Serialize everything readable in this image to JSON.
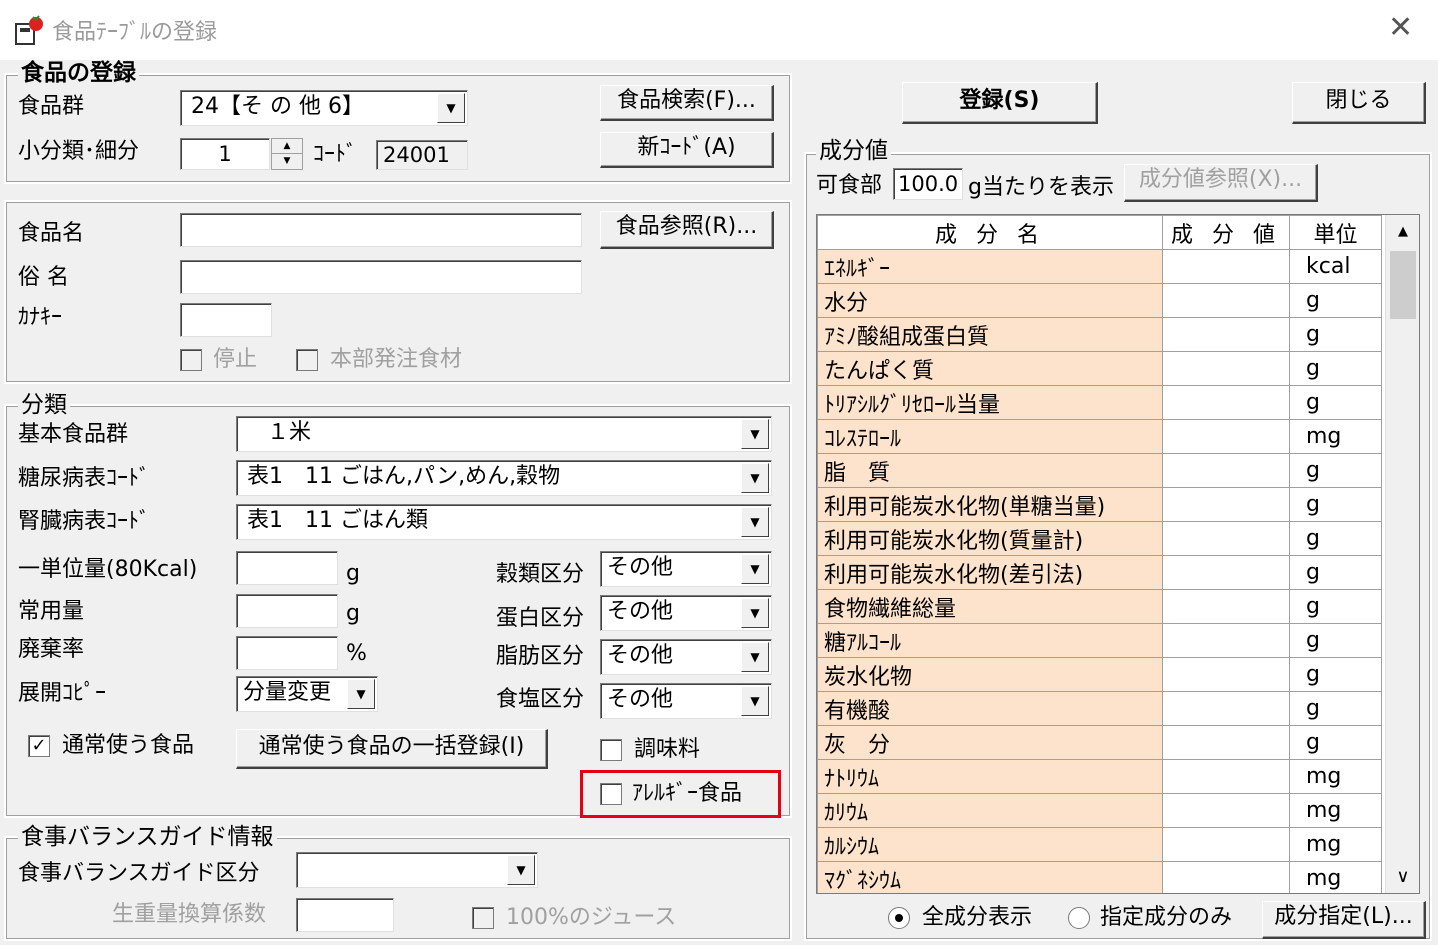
{
  "window": {
    "title": "食品ﾃｰﾌﾞﾙの登録",
    "close_glyph": "✕"
  },
  "food_reg": {
    "group_title": "食品の登録",
    "food_group_label": "食品群",
    "food_group_value": "24【そ の 他 6】",
    "subclass_label": "小分類･細分",
    "subclass_value": "1",
    "code_label": "ｺｰﾄﾞ",
    "code_value": "24001",
    "search_button": "食品検索(F)...",
    "newcode_button": "新ｺｰﾄﾞ(A)"
  },
  "top_buttons": {
    "register": "登録(S)",
    "close": "閉じる"
  },
  "name_section": {
    "food_name_label": "食品名",
    "common_name_label": "俗 名",
    "kana_key_label": "ｶﾅｷｰ",
    "food_ref_button": "食品参照(R)...",
    "stop_label": "停止",
    "hq_order_label": "本部発注食材"
  },
  "classification": {
    "group_title": "分類",
    "basic_group_label": "基本食品群",
    "basic_group_value": "１米",
    "diabetes_label": "糖尿病表ｺｰﾄﾞ",
    "diabetes_value": "表1　11 ごはん,パン,めん,穀物",
    "kidney_label": "腎臓病表ｺｰﾄﾞ",
    "kidney_value": "表1　11 ごはん類",
    "unit_label": "一単位量(80Kcal)",
    "unit_suffix": "g",
    "normal_amount_label": "常用量",
    "normal_suffix": "g",
    "waste_label": "廃棄率",
    "waste_suffix": "%",
    "expand_copy_label": "展開ｺﾋﾟｰ",
    "expand_copy_value": "分量変更",
    "grain_label": "穀類区分",
    "grain_value": "その他",
    "protein_label": "蛋白区分",
    "protein_value": "その他",
    "fat_label": "脂肪区分",
    "fat_value": "その他",
    "salt_label": "食塩区分",
    "salt_value": "その他",
    "usual_food_label": "通常使う食品",
    "usual_food_checked": true,
    "bulk_button": "通常使う食品の一括登録(I)",
    "seasoning_label": "調味料",
    "allergy_label": "ｱﾚﾙｷﾞｰ食品"
  },
  "balance": {
    "group_title": "食事バランスガイド情報",
    "category_label": "食事バランスガイド区分",
    "factor_label": "生重量換算係数",
    "juice_label": "100%のジュース"
  },
  "nutrients": {
    "group_title": "成分値",
    "edible_label": "可食部",
    "edible_value": "100.0",
    "per_label": "g当たりを表示",
    "ref_button": "成分値参照(X)...",
    "headers": [
      "成 分 名",
      "成 分 値",
      "単位"
    ],
    "rows": [
      {
        "name": "ｴﾈﾙｷﾞｰ",
        "unit": "kcal"
      },
      {
        "name": "水分",
        "unit": "g"
      },
      {
        "name": "ｱﾐﾉ酸組成蛋白質",
        "unit": "g"
      },
      {
        "name": "たんぱく質",
        "unit": "g"
      },
      {
        "name": "ﾄﾘｱｼﾙｸﾞﾘｾﾛｰﾙ当量",
        "unit": "g"
      },
      {
        "name": "ｺﾚｽﾃﾛｰﾙ",
        "unit": "mg"
      },
      {
        "name": "脂　質",
        "unit": "g"
      },
      {
        "name": "利用可能炭水化物(単糖当量)",
        "unit": "g"
      },
      {
        "name": "利用可能炭水化物(質量計)",
        "unit": "g"
      },
      {
        "name": "利用可能炭水化物(差引法)",
        "unit": "g"
      },
      {
        "name": "食物繊維総量",
        "unit": "g"
      },
      {
        "name": "糖ｱﾙｺｰﾙ",
        "unit": "g"
      },
      {
        "name": "炭水化物",
        "unit": "g"
      },
      {
        "name": "有機酸",
        "unit": "g"
      },
      {
        "name": "灰　分",
        "unit": "g"
      },
      {
        "name": "ﾅﾄﾘｳﾑ",
        "unit": "mg"
      },
      {
        "name": "ｶﾘｳﾑ",
        "unit": "mg"
      },
      {
        "name": "ｶﾙｼｳﾑ",
        "unit": "mg"
      },
      {
        "name": "ﾏｸﾞﾈｼｳﾑ",
        "unit": "mg"
      }
    ],
    "all_label": "全成分表示",
    "selected_label": "指定成分のみ",
    "specify_button": "成分指定(L)...",
    "scroll_up": "▲",
    "scroll_down": "∨"
  },
  "icons": {
    "combo_arrow": "▼",
    "spin_up": "▲",
    "spin_down": "▼",
    "check": "✓"
  }
}
